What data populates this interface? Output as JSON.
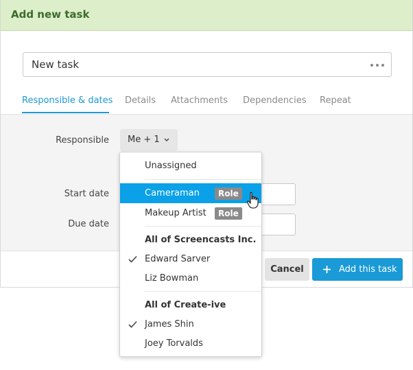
{
  "dialog": {
    "title": "Add new task",
    "task_name_value": "New task"
  },
  "tabs": [
    {
      "label": "Responsible & dates",
      "active": true
    },
    {
      "label": "Details",
      "active": false
    },
    {
      "label": "Attachments",
      "active": false
    },
    {
      "label": "Dependencies",
      "active": false
    },
    {
      "label": "Repeat",
      "active": false
    }
  ],
  "form": {
    "responsible_label": "Responsible",
    "responsible_value": "Me + 1",
    "start_date_label": "Start date",
    "due_date_label": "Due date"
  },
  "buttons": {
    "cancel": "Cancel",
    "add": "Add this task"
  },
  "dropdown": {
    "unassigned": "Unassigned",
    "roles": [
      {
        "label": "Cameraman",
        "badge": "Role",
        "highlighted": true
      },
      {
        "label": "Makeup Artist",
        "badge": "Role",
        "highlighted": false
      }
    ],
    "groups": [
      {
        "header": "All of Screencasts Inc.",
        "members": [
          {
            "label": "Edward Sarver",
            "checked": true
          },
          {
            "label": "Liz Bowman",
            "checked": false
          }
        ]
      },
      {
        "header": "All of Create-ive",
        "members": [
          {
            "label": "James Shin",
            "checked": true
          },
          {
            "label": "Joey Torvalds",
            "checked": false
          }
        ]
      }
    ]
  },
  "colors": {
    "header_bg": "#dcefca",
    "header_text": "#3e6a2b",
    "accent": "#1a9ad6",
    "highlight": "#0ba1e8",
    "role_badge": "#8a8a8a"
  }
}
